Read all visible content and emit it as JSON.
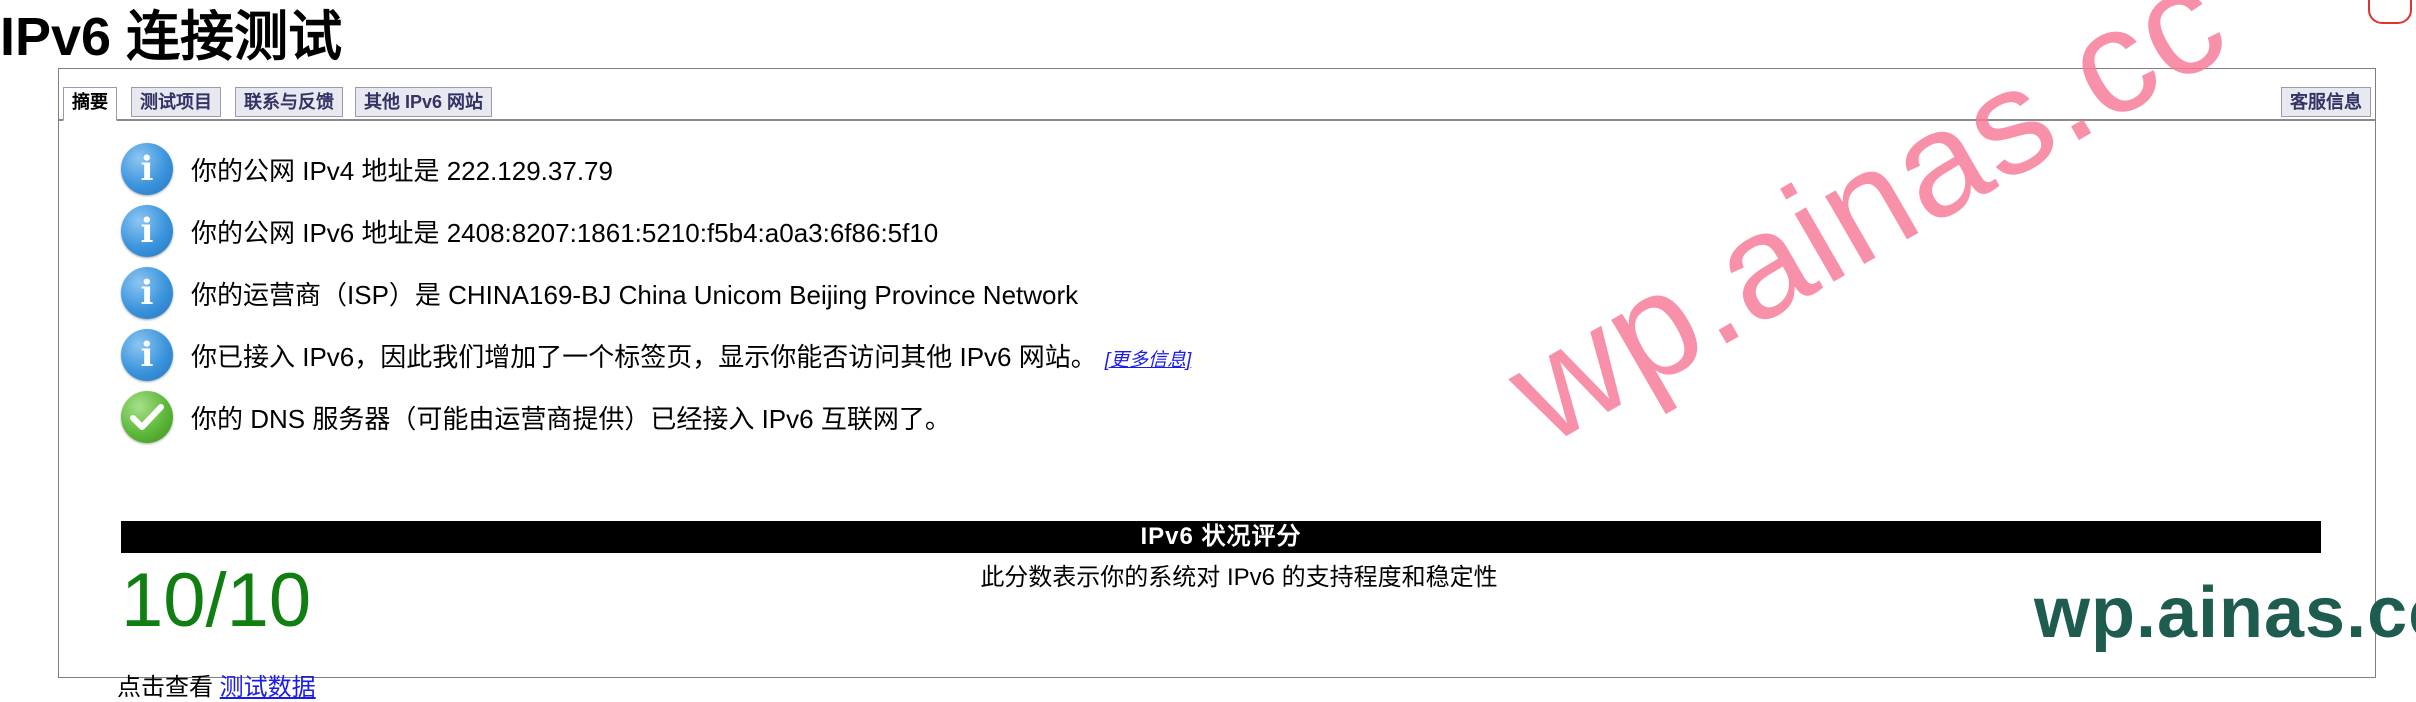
{
  "page": {
    "title": "IPv6 连接测试"
  },
  "tabs": [
    {
      "label": "摘要"
    },
    {
      "label": "测试项目"
    },
    {
      "label": "联系与反馈"
    },
    {
      "label": "其他 IPv6 网站"
    },
    {
      "label": "客服信息"
    }
  ],
  "summary": {
    "rows": [
      {
        "icon": "info-icon",
        "text": "你的公网 IPv4 地址是 222.129.37.79"
      },
      {
        "icon": "info-icon",
        "text": "你的公网 IPv6 地址是 2408:8207:1861:5210:f5b4:a0a3:6f86:5f10"
      },
      {
        "icon": "info-icon",
        "text": "你的运营商（ISP）是 CHINA169-BJ China Unicom Beijing Province Network"
      },
      {
        "icon": "info-icon",
        "text": "你已接入 IPv6，因此我们增加了一个标签页，显示你能否访问其他 IPv6 网站。",
        "link": "[更多信息]"
      },
      {
        "icon": "checkmark-icon",
        "text": "你的 DNS 服务器（可能由运营商提供）已经接入 IPv6 互联网了。"
      }
    ]
  },
  "score": {
    "heading": "IPv6 状况评分",
    "value": "10/10",
    "description": "此分数表示你的系统对 IPv6 的支持程度和稳定性",
    "color": "#107e10"
  },
  "footer": {
    "prefix": "点击查看",
    "link": "测试数据"
  },
  "watermark": {
    "diagonal": "wp.ainas.cc",
    "logo": "wp.ainas.cc",
    "diagonal_color": "#f67896",
    "logo_color": "#1d5c4f"
  }
}
